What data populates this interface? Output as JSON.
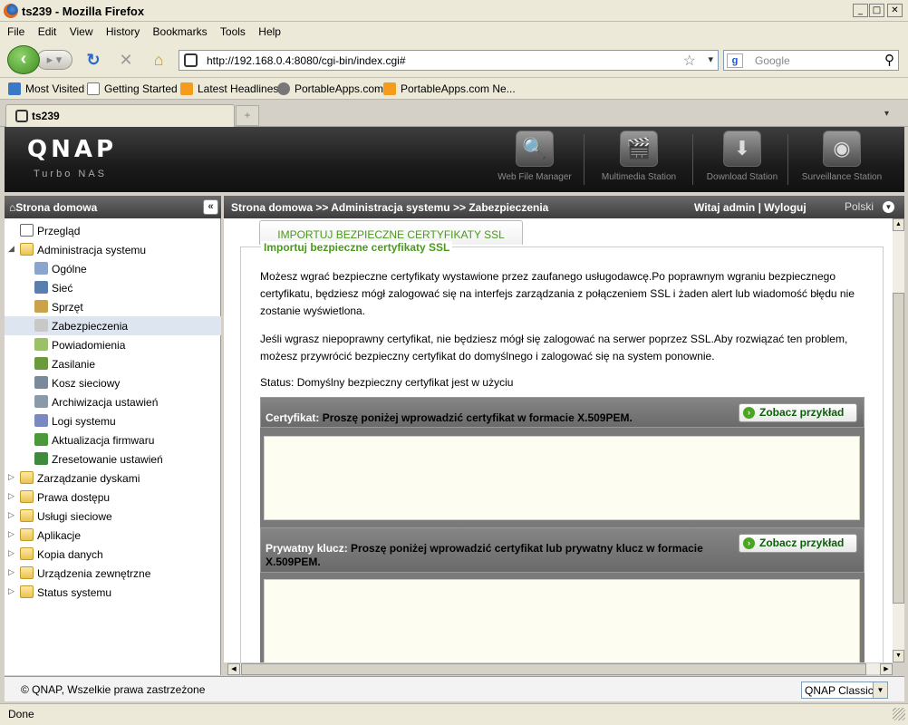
{
  "window": {
    "title": "ts239 - Mozilla Firefox",
    "minimize": "_",
    "maximize": "□",
    "close": "✕"
  },
  "menu": [
    "File",
    "Edit",
    "View",
    "History",
    "Bookmarks",
    "Tools",
    "Help"
  ],
  "nav": {
    "url": "http://192.168.0.4:8080/cgi-bin/index.cgi#",
    "search_placeholder": "Google"
  },
  "bookmarks": [
    "Most Visited",
    "Getting Started",
    "Latest Headlines",
    "PortableApps.com",
    "PortableApps.com Ne..."
  ],
  "tab": {
    "title": "ts239"
  },
  "qnap": {
    "logo": "QNAP",
    "subtitle": "Turbo NAS",
    "header_icons": [
      "Web File Manager",
      "Multimedia Station",
      "Download Station",
      "Surveillance Station"
    ]
  },
  "sidebar": {
    "title": "Strona domowa",
    "items": [
      {
        "label": "Przegląd",
        "level": 0,
        "icon": "doc"
      },
      {
        "label": "Administracja systemu",
        "level": 0,
        "icon": "folder",
        "expanded": true
      },
      {
        "label": "Ogólne",
        "level": 1,
        "icon": "gear"
      },
      {
        "label": "Sieć",
        "level": 1,
        "icon": "network"
      },
      {
        "label": "Sprzęt",
        "level": 1,
        "icon": "hardware"
      },
      {
        "label": "Zabezpieczenia",
        "level": 1,
        "icon": "lock",
        "selected": true
      },
      {
        "label": "Powiadomienia",
        "level": 1,
        "icon": "notify"
      },
      {
        "label": "Zasilanie",
        "level": 1,
        "icon": "power"
      },
      {
        "label": "Kosz sieciowy",
        "level": 1,
        "icon": "recycle"
      },
      {
        "label": "Archiwizacja ustawień",
        "level": 1,
        "icon": "backup"
      },
      {
        "label": "Logi systemu",
        "level": 1,
        "icon": "log"
      },
      {
        "label": "Aktualizacja firmwaru",
        "level": 1,
        "icon": "firmware"
      },
      {
        "label": "Zresetowanie ustawień",
        "level": 1,
        "icon": "reset"
      },
      {
        "label": "Zarządzanie dyskami",
        "level": 0,
        "icon": "folder"
      },
      {
        "label": "Prawa dostępu",
        "level": 0,
        "icon": "folder"
      },
      {
        "label": "Usługi sieciowe",
        "level": 0,
        "icon": "folder"
      },
      {
        "label": "Aplikacje",
        "level": 0,
        "icon": "folder"
      },
      {
        "label": "Kopia danych",
        "level": 0,
        "icon": "folder"
      },
      {
        "label": "Urządzenia zewnętrzne",
        "level": 0,
        "icon": "folder"
      },
      {
        "label": "Status systemu",
        "level": 0,
        "icon": "folder"
      }
    ]
  },
  "breadcrumb": "Strona domowa >> Administracja systemu >> Zabezpieczenia",
  "welcome": "Witaj admin",
  "logout": "Wyloguj",
  "language": "Polski",
  "main": {
    "tab_label": "IMPORTUJ BEZPIECZNE CERTYFIKATY SSL",
    "legend": "Importuj bezpieczne certyfikaty SSL",
    "para1": "Możesz wgrać bezpieczne certyfikaty wystawione przez zaufanego usługodawcę.Po poprawnym wgraniu bezpiecznego certyfikatu, będziesz mógł zalogować się na interfejs zarządzania z połączeniem SSL i żaden alert lub wiadomość błędu nie zostanie wyświetlona.",
    "para2": "Jeśli wgrasz niepoprawny certyfikat, nie będziesz mógł się zalogować na serwer poprzez SSL.Aby rozwiązać ten problem, możesz przywrócić bezpieczny certyfikat do domyślnego i zalogować się na system ponownie.",
    "status": "Status: Domyślny bezpieczny certyfikat jest w użyciu",
    "cert_label": "Certyfikat:",
    "cert_desc": " Proszę poniżej wprowadzić certyfikat w formacie X.509PEM.",
    "key_label": "Prywatny klucz:",
    "key_desc": " Proszę poniżej wprowadzić certyfikat lub prywatny klucz w formacie X.509PEM.",
    "example_button": "Zobacz przykład"
  },
  "footer": {
    "copyright": "© QNAP, Wszelkie prawa zastrzeżone",
    "theme_select": "QNAP Classic"
  },
  "status_bar": "Done"
}
